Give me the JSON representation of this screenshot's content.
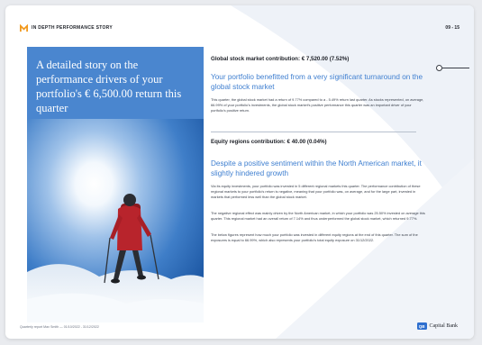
{
  "header": {
    "story_label": "IN DEPTH PERFORMANCE STORY",
    "page_number": "09 - 15",
    "logo_icon": "orange-m-logo-icon"
  },
  "hero": {
    "title": "A detailed story on the performance drivers of your portfolio's € 6,500.00 return this quarter",
    "photo_icon": "mountaineer-photo"
  },
  "global_section": {
    "heading": "Global stock market contribution: € 7,520.00 (7.52%)",
    "title": "Your portfolio benefitted from a very significant turnaround on the global stock market",
    "paragraphs": [
      "This quarter, the global stock market had a return of 9.77% compared to a - 5.49% return last quarter. As stocks represented, on average, 66.99% of your portfolio's investments, the global stock market's positive performance this quarter was an important driver of your portfolio's positive return."
    ]
  },
  "equity_section": {
    "heading": "Equity regions contribution: € 40.00 (0.04%)",
    "title": "Despite a positive sentiment within the North American market, it slightly hindered growth",
    "paragraphs": [
      "Via its equity investments, your portfolio was invested in 5 different regional markets this quarter. The performance contribution of these regional markets to your portfolio's return is negative, meaning that your portfolio was, on average, and for the large part, invested in markets that performed less well than the global stock market.",
      "The negative regional effect was mainly driven by the North American market, in which your portfolio was 25.50% invested on average this quarter. This regional market had an overall return of 7.14% and thus underperformed the global stock market, which returned 9.77%.",
      "The below figures represent how much your portfolio was invested in different equity regions at the end of this quarter. The sum of the exposures is equal to 66.99%, which also represents your portfolio's total equity exposure on 31/12/2022."
    ]
  },
  "footer": {
    "left_text": "Quarterly report Max Smith  —  01/10/2022 - 31/12/2022",
    "bank_badge": "QB",
    "bank_name": "Capital Bank"
  },
  "colors": {
    "accent_blue": "#3f7fd0",
    "hero_blue": "#4a86cf",
    "logo_orange": "#f29a1f",
    "jacket_red": "#b8242c"
  }
}
